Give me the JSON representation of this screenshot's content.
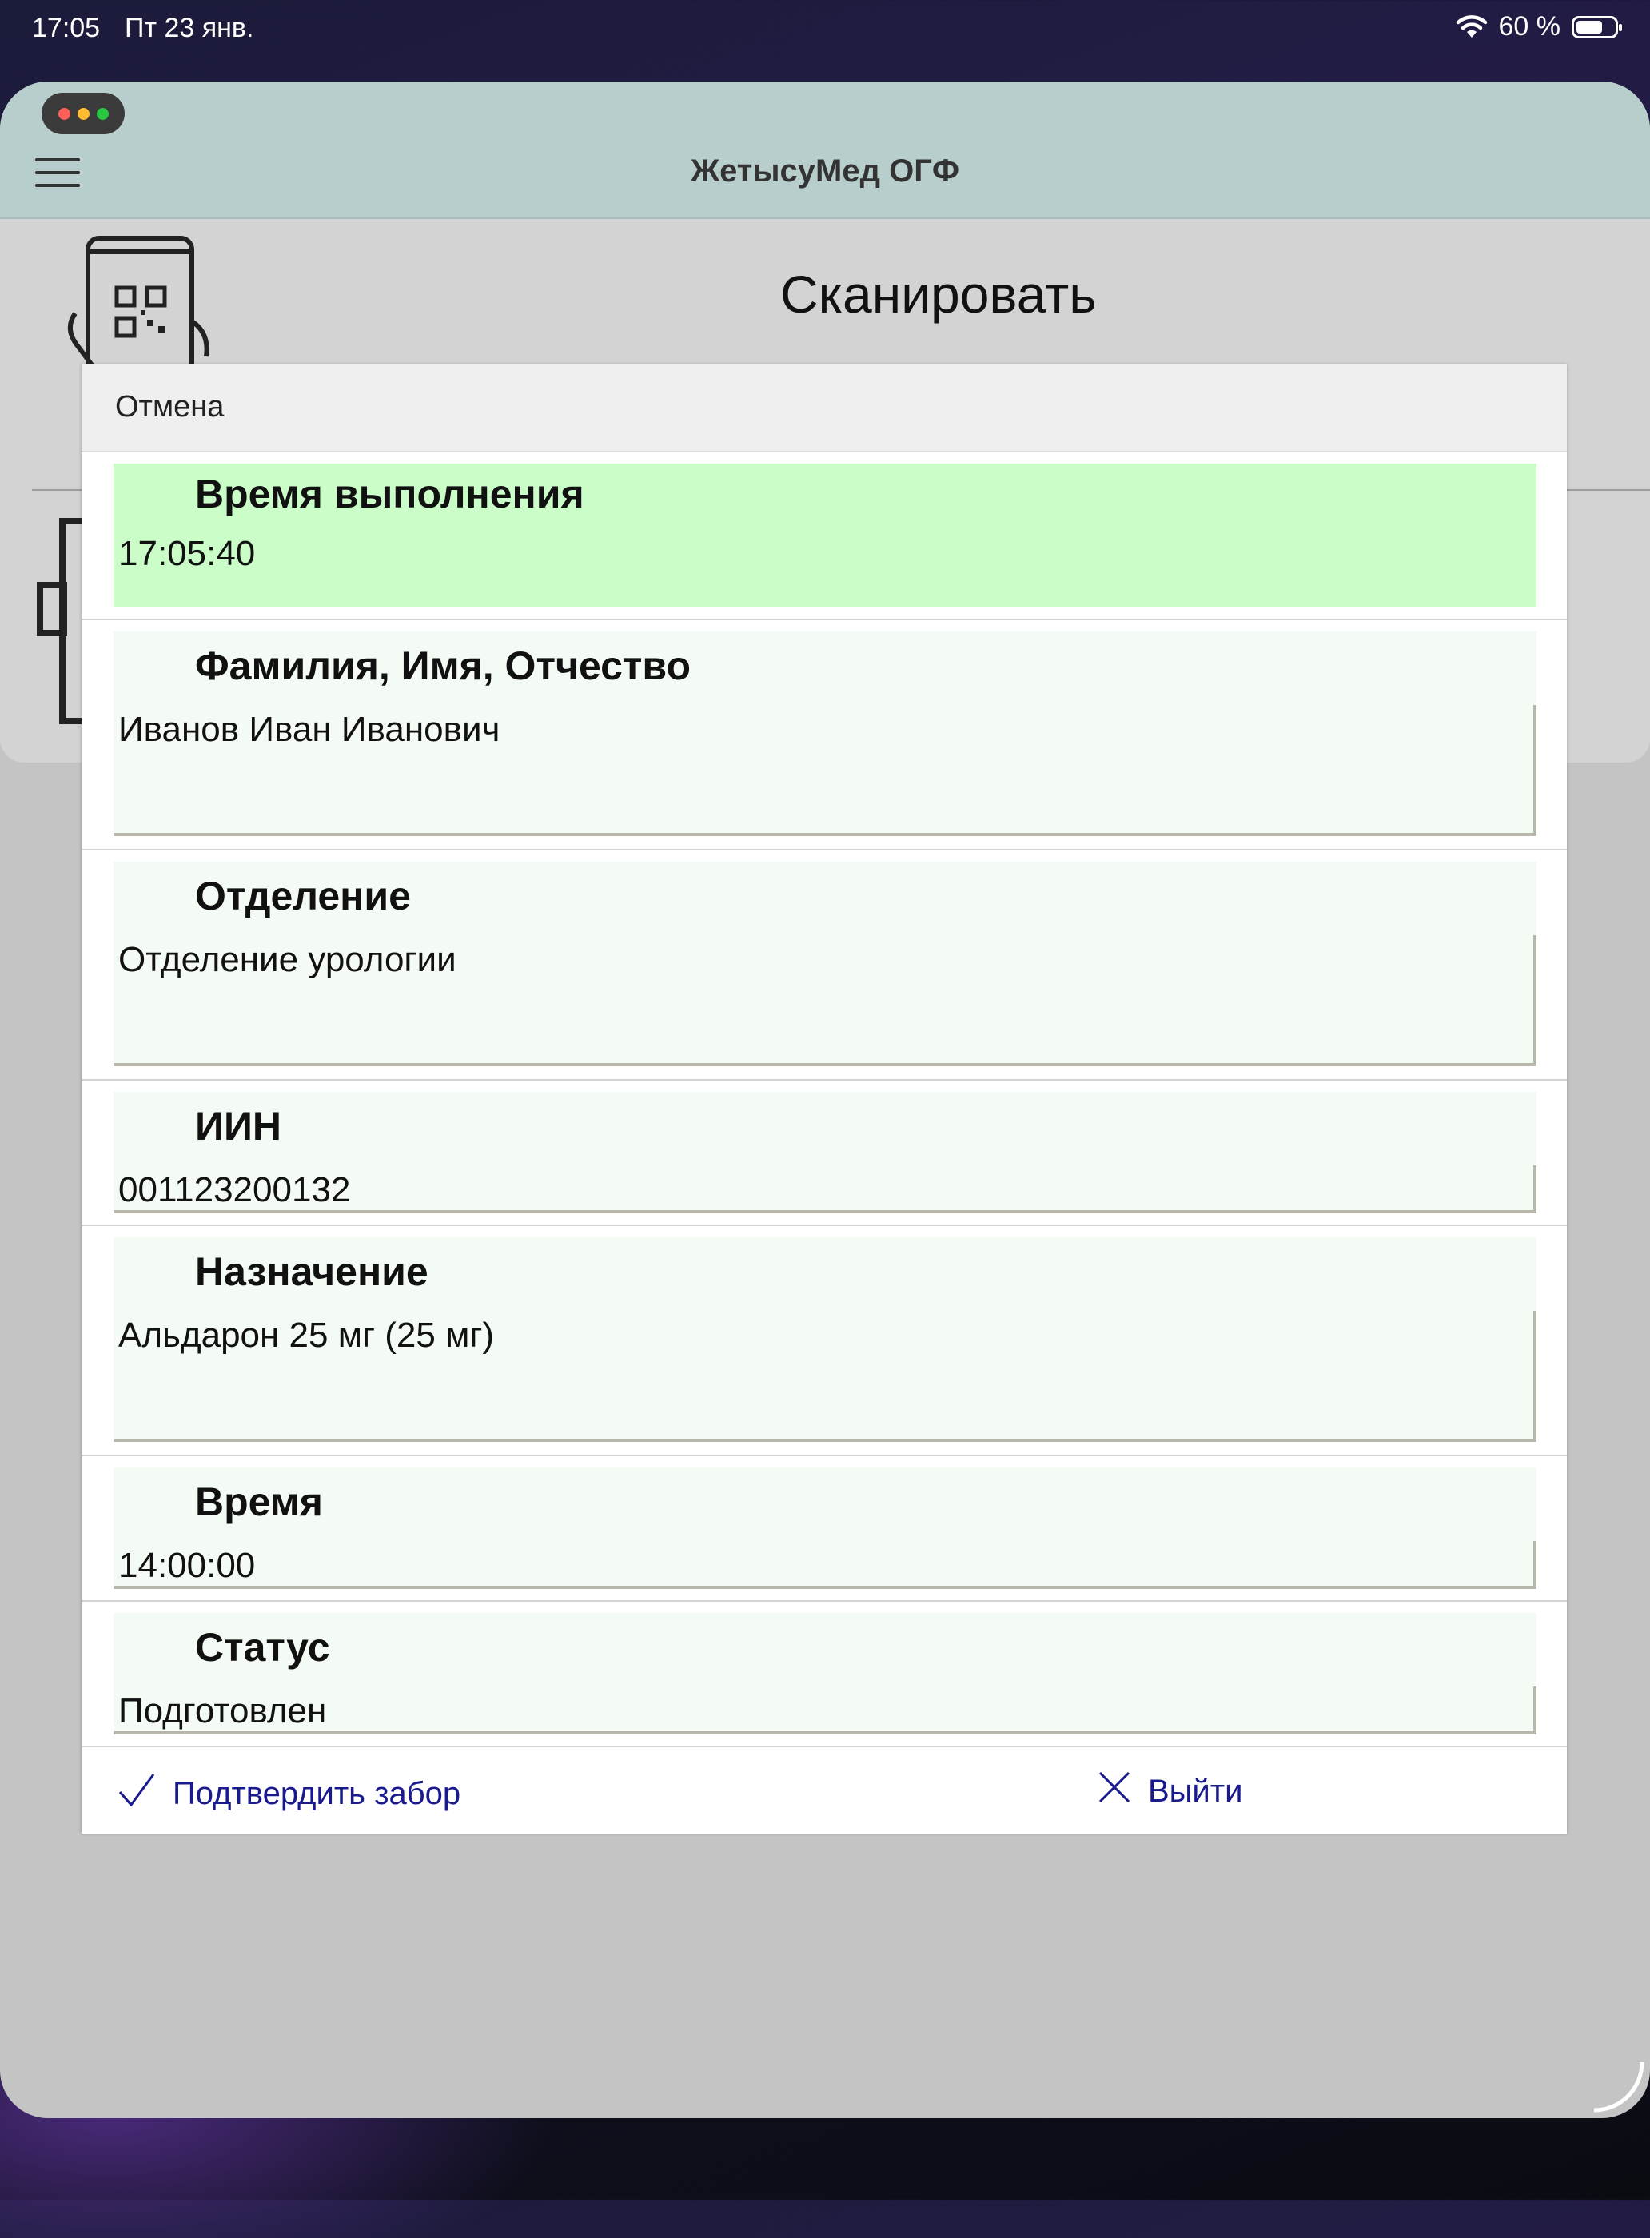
{
  "status_bar": {
    "time": "17:05",
    "date": "Пт 23 янв.",
    "battery": "60 %",
    "battery_level": 0.6,
    "icons": [
      "wifi-icon",
      "battery-icon"
    ]
  },
  "app": {
    "title": "ЖетысуМед ОГФ",
    "menu_icon": "hamburger-icon",
    "window_controls": [
      "close",
      "minimize",
      "zoom"
    ]
  },
  "page": {
    "scan_label": "Сканировать",
    "icons": [
      "qr-scan-phone-icon",
      "scanner-device-icon"
    ]
  },
  "modal": {
    "cancel_label": "Отмена",
    "fields": [
      {
        "label": "Время выполнения",
        "value": "17:05:40"
      },
      {
        "label": "Фамилия, Имя, Отчество",
        "value": "Иванов Иван  Иванович"
      },
      {
        "label": "Отделение",
        "value": "Отделение урологии"
      },
      {
        "label": "ИИН",
        "value": "001123200132"
      },
      {
        "label": "Назначение",
        "value": "Альдарон 25 мг (25 мг)"
      },
      {
        "label": "Время",
        "value": "14:00:00"
      },
      {
        "label": "Статус",
        "value": "Подготовлен"
      }
    ],
    "actions": {
      "confirm_label": "Подтвердить забор",
      "confirm_icon": "checkmark-icon",
      "exit_label": "Выйти",
      "exit_icon": "close-icon"
    },
    "colors": {
      "highlight": "#cbfdc8",
      "field_bg": "#f4faf4",
      "action_text": "#1a1a8f"
    }
  }
}
